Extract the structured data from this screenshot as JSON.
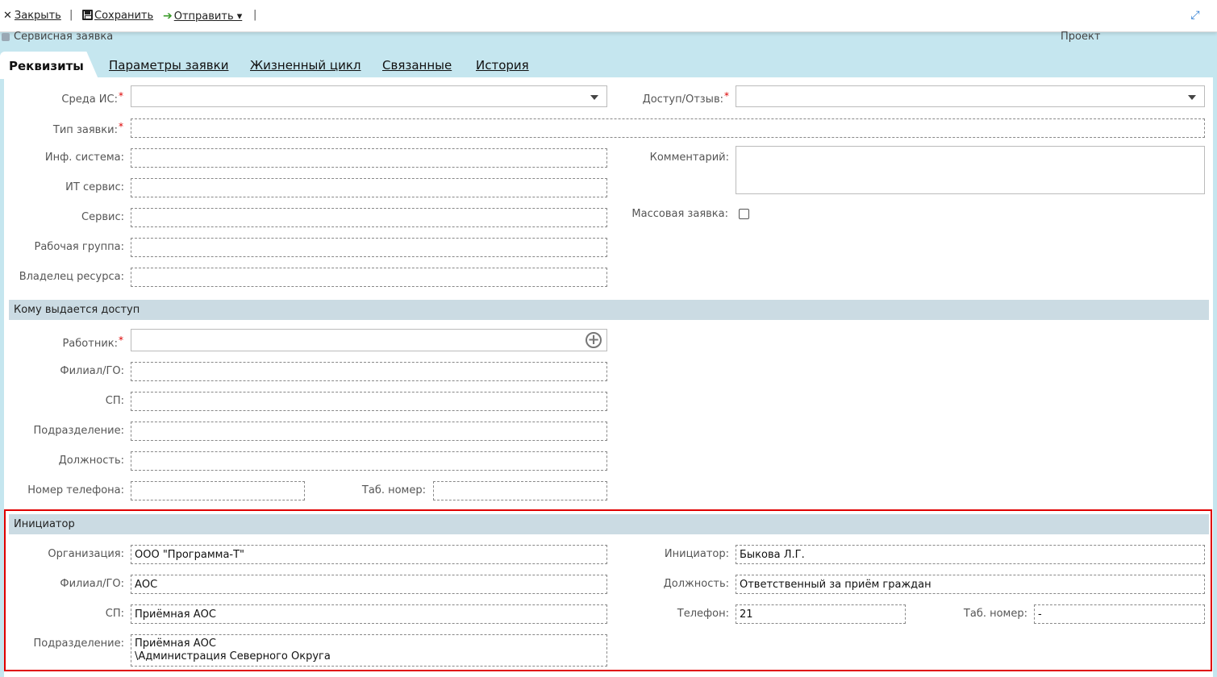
{
  "toolbar": {
    "close_label": "Закрыть",
    "save_label": "Сохранить",
    "send_label": "Отправить ▾",
    "separator": "|",
    "expand_icon": "expand-icon"
  },
  "document": {
    "title": "Сервисная заявка",
    "status": "Проект"
  },
  "tabs": [
    {
      "label": "Реквизиты",
      "active": true
    },
    {
      "label": "Параметры заявки"
    },
    {
      "label": "Жизненный цикл"
    },
    {
      "label": "Связанные"
    },
    {
      "label": "История"
    }
  ],
  "requisites": {
    "env_label": "Среда ИС:",
    "access_label": "Доступ/Отзыв:",
    "type_label": "Тип заявки:",
    "inf_system_label": "Инф. система:",
    "it_service_label": "ИТ сервис:",
    "service_label": "Сервис:",
    "work_group_label": "Рабочая группа:",
    "resource_owner_label": "Владелец ресурса:",
    "comment_label": "Комментарий:",
    "mass_label": "Массовая заявка:",
    "required_mark": "*"
  },
  "access_to": {
    "header": "Кому выдается доступ",
    "worker_label": "Работник:",
    "branch_label": "Филиал/ГО:",
    "sp_label": "СП:",
    "department_label": "Подразделение:",
    "position_label": "Должность:",
    "phone_label": "Номер телефона:",
    "tab_label": "Таб. номер:"
  },
  "initiator": {
    "header": "Инициатор",
    "org_label": "Организация:",
    "org_value": "ООО \"Программа-Т\"",
    "branch_label": "Филиал/ГО:",
    "branch_value": "АОС",
    "sp_label": "СП:",
    "sp_value": "Приёмная АОС",
    "department_label": "Подразделение:",
    "department_value_line1": "Приёмная АОС",
    "department_value_line2": "\\Администрация Северного Округа",
    "initiator_label": "Инициатор:",
    "initiator_value": "Быкова Л.Г.",
    "position_label": "Должность:",
    "position_value": "Ответственный за приём граждан",
    "phone_label": "Телефон:",
    "phone_value": "21",
    "tab_label": "Таб. номер:",
    "tab_value": "-"
  },
  "colors": {
    "background": "#c5e6ef",
    "section": "#cbdbe3",
    "highlight": "#e00000",
    "required": "#d00000"
  }
}
